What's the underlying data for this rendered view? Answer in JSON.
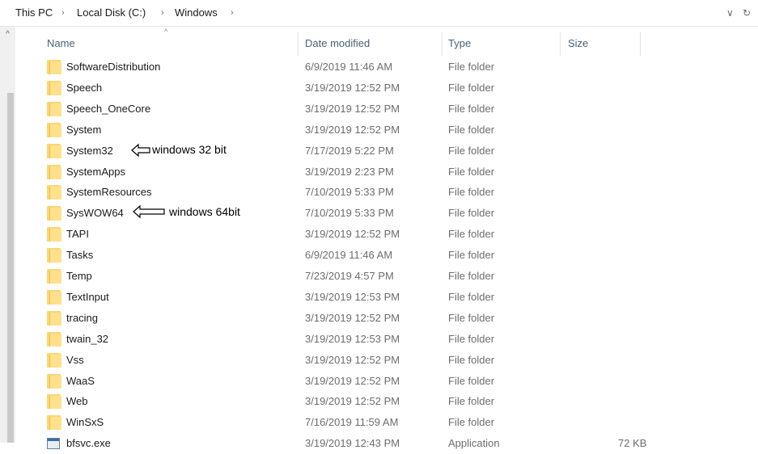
{
  "breadcrumb": {
    "items": [
      "This PC",
      "Local Disk (C:)",
      "Windows"
    ],
    "separator": "›",
    "trailing": "›"
  },
  "address_controls": {
    "dropdown": "∨",
    "refresh": "↻"
  },
  "scrollbar": {
    "up_arrow": "^"
  },
  "columns": {
    "name": "Name",
    "date": "Date modified",
    "type": "Type",
    "size": "Size",
    "sort_indicator": "^"
  },
  "rows": [
    {
      "name": "SoftwareDistribution",
      "date": "6/9/2019 11:46 AM",
      "type": "File folder",
      "size": "",
      "icon": "folder-icon"
    },
    {
      "name": "Speech",
      "date": "3/19/2019 12:52 PM",
      "type": "File folder",
      "size": "",
      "icon": "folder-icon"
    },
    {
      "name": "Speech_OneCore",
      "date": "3/19/2019 12:52 PM",
      "type": "File folder",
      "size": "",
      "icon": "folder-icon"
    },
    {
      "name": "System",
      "date": "3/19/2019 12:52 PM",
      "type": "File folder",
      "size": "",
      "icon": "folder-icon"
    },
    {
      "name": "System32",
      "date": "7/17/2019 5:22 PM",
      "type": "File folder",
      "size": "",
      "icon": "folder-icon"
    },
    {
      "name": "SystemApps",
      "date": "3/19/2019 2:23 PM",
      "type": "File folder",
      "size": "",
      "icon": "folder-icon"
    },
    {
      "name": "SystemResources",
      "date": "7/10/2019 5:33 PM",
      "type": "File folder",
      "size": "",
      "icon": "folder-icon"
    },
    {
      "name": "SysWOW64",
      "date": "7/10/2019 5:33 PM",
      "type": "File folder",
      "size": "",
      "icon": "folder-icon"
    },
    {
      "name": "TAPI",
      "date": "3/19/2019 12:52 PM",
      "type": "File folder",
      "size": "",
      "icon": "folder-icon"
    },
    {
      "name": "Tasks",
      "date": "6/9/2019 11:46 AM",
      "type": "File folder",
      "size": "",
      "icon": "folder-icon"
    },
    {
      "name": "Temp",
      "date": "7/23/2019 4:57 PM",
      "type": "File folder",
      "size": "",
      "icon": "folder-icon"
    },
    {
      "name": "TextInput",
      "date": "3/19/2019 12:53 PM",
      "type": "File folder",
      "size": "",
      "icon": "folder-icon"
    },
    {
      "name": "tracing",
      "date": "3/19/2019 12:52 PM",
      "type": "File folder",
      "size": "",
      "icon": "folder-icon"
    },
    {
      "name": "twain_32",
      "date": "3/19/2019 12:53 PM",
      "type": "File folder",
      "size": "",
      "icon": "folder-icon"
    },
    {
      "name": "Vss",
      "date": "3/19/2019 12:52 PM",
      "type": "File folder",
      "size": "",
      "icon": "folder-icon"
    },
    {
      "name": "WaaS",
      "date": "3/19/2019 12:52 PM",
      "type": "File folder",
      "size": "",
      "icon": "folder-icon"
    },
    {
      "name": "Web",
      "date": "3/19/2019 12:52 PM",
      "type": "File folder",
      "size": "",
      "icon": "folder-icon"
    },
    {
      "name": "WinSxS",
      "date": "7/16/2019 11:59 AM",
      "type": "File folder",
      "size": "",
      "icon": "folder-icon"
    },
    {
      "name": "bfsvc.exe",
      "date": "3/19/2019 12:43 PM",
      "type": "Application",
      "size": "72 KB",
      "icon": "application-icon"
    }
  ],
  "annotations": {
    "system32_note": "windows 32 bit",
    "syswow64_note": "windows 64bit"
  }
}
